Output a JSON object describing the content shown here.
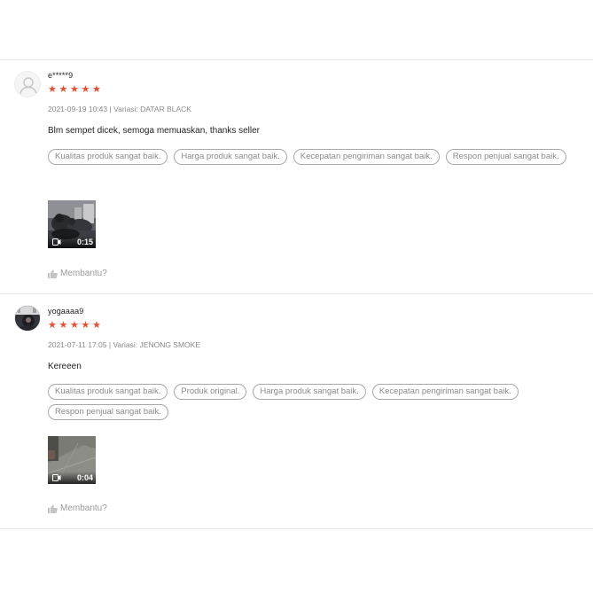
{
  "reviews": [
    {
      "username": "e*****9",
      "rating": 5,
      "datetime": "2021-09-19 10:43",
      "variation_label": "Variasi:",
      "variation": "DATAR BLACK",
      "comment": "Blm sempet dicek, semoga memuaskan, thanks seller",
      "tags": [
        "Kualitas produk sangat baik.",
        "Harga produk sangat baik.",
        "Kecepatan pengiriman sangat baik.",
        "Respon penjual sangat baik."
      ],
      "video_duration": "0:15",
      "helpful_label": "Membantu?"
    },
    {
      "username": "yogaaaa9",
      "rating": 5,
      "datetime": "2021-07-11 17:05",
      "variation_label": "Variasi:",
      "variation": "JENONG SMOKE",
      "comment": "Kereeen",
      "tags": [
        "Kualitas produk sangat baik.",
        "Produk original.",
        "Harga produk sangat baik.",
        "Kecepatan pengiriman sangat baik.",
        "Respon penjual sangat baik."
      ],
      "video_duration": "0:04",
      "helpful_label": "Membantu?"
    }
  ],
  "colors": {
    "star": "#ee4d2d",
    "tag_border": "#a8a8a8",
    "muted": "#888888"
  },
  "icons": {
    "star": "star-icon",
    "avatar": "default-avatar-icon",
    "camera": "video-camera-icon",
    "thumb": "thumbs-up-icon"
  }
}
